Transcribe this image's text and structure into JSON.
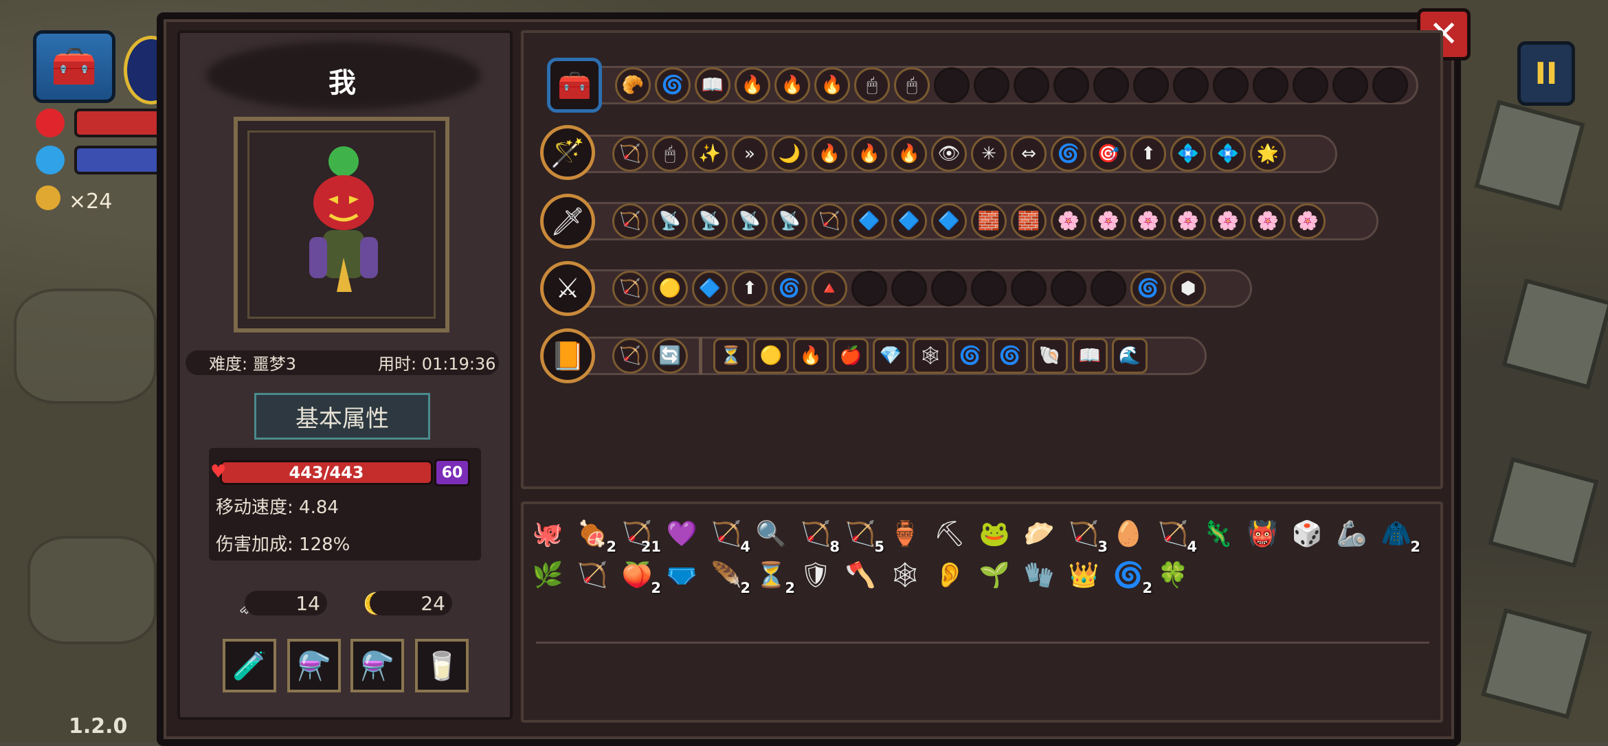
{
  "hud": {
    "coin_count": "×24",
    "version": "1.2.0",
    "pause_label": "II",
    "hp_color": "#c52d2d",
    "mp_color": "#3a4fb0"
  },
  "panel": {
    "close_label": "✕",
    "player_name": "我",
    "difficulty": "难度: 噩梦3",
    "time_used": "用时: 01:19:36",
    "tab_basic": "基本属性",
    "hp_text": "443/443",
    "shield_value": "60",
    "move_speed": "移动速度: 4.84",
    "damage_bonus": "伤害加成: 128%",
    "keys": "14",
    "coins": "24",
    "potions": [
      "🧪",
      "⚗️",
      "⚗️",
      "🥛"
    ]
  },
  "loadout": {
    "row1": {
      "weapon_icon": "chest-icon",
      "weapon_glyph": "🧰",
      "slots": [
        "🥐",
        "🌀",
        "📖",
        "🔥",
        "🔥",
        "🔥",
        "🖱",
        "🖱",
        "",
        "",
        "",
        "",
        "",
        "",
        "",
        "",
        "",
        "",
        "",
        ""
      ]
    },
    "row2": {
      "weapon_glyph": "🪄",
      "slots": [
        "🏹",
        "🖱",
        "✨",
        "»",
        "🌙",
        "🔥",
        "🔥",
        "🔥",
        "👁",
        "✳",
        "⇔",
        "🌀",
        "🎯",
        "⬆",
        "💠",
        "💠",
        "🌟"
      ]
    },
    "row3": {
      "weapon_glyph": "🗡",
      "slots": [
        "🏹",
        "📡",
        "📡",
        "📡",
        "📡",
        "🏹",
        "🔷",
        "🔷",
        "🔷",
        "🧱",
        "🧱",
        "🌸",
        "🌸",
        "🌸",
        "🌸",
        "🌸",
        "🌸",
        "🌸"
      ]
    },
    "row4": {
      "weapon_glyph": "⚔",
      "slots": [
        "🏹",
        "🟡",
        "🔷",
        "⬆",
        "🌀",
        "🔺",
        "",
        "",
        "",
        "",
        "",
        "",
        "",
        "🌀",
        "⬢"
      ]
    },
    "row5": {
      "weapon_glyph": "📙",
      "slots_a": [
        "🏹",
        "🔄"
      ],
      "slots_b": [
        "⏳",
        "🟡",
        "🔥",
        "🍎",
        "💎",
        "🕸",
        "🌀",
        "🌀",
        "🐚",
        "📖",
        "🌊"
      ]
    }
  },
  "inventory": {
    "row1": [
      {
        "g": "🐙",
        "c": ""
      },
      {
        "g": "🍖",
        "c": "2"
      },
      {
        "g": "🏹",
        "c": "21"
      },
      {
        "g": "💜",
        "c": ""
      },
      {
        "g": "🏹",
        "c": "4"
      },
      {
        "g": "🔍",
        "c": ""
      },
      {
        "g": "🏹",
        "c": "8"
      },
      {
        "g": "🏹",
        "c": "5"
      },
      {
        "g": "🏺",
        "c": ""
      },
      {
        "g": "⛏",
        "c": ""
      },
      {
        "g": "🐸",
        "c": ""
      },
      {
        "g": "🥟",
        "c": ""
      },
      {
        "g": "🏹",
        "c": "3"
      },
      {
        "g": "🥚",
        "c": ""
      },
      {
        "g": "🏹",
        "c": "4"
      },
      {
        "g": "🦎",
        "c": ""
      },
      {
        "g": "👹",
        "c": ""
      },
      {
        "g": "🎲",
        "c": ""
      },
      {
        "g": "🦾",
        "c": ""
      },
      {
        "g": "🧥",
        "c": "2"
      }
    ],
    "row2": [
      {
        "g": "🌿",
        "c": ""
      },
      {
        "g": "🏹",
        "c": ""
      },
      {
        "g": "🍑",
        "c": "2"
      },
      {
        "g": "🩲",
        "c": ""
      },
      {
        "g": "🪶",
        "c": "2"
      },
      {
        "g": "⏳",
        "c": "2"
      },
      {
        "g": "🛡",
        "c": ""
      },
      {
        "g": "🪓",
        "c": ""
      },
      {
        "g": "🕸",
        "c": ""
      },
      {
        "g": "👂",
        "c": ""
      },
      {
        "g": "🌱",
        "c": ""
      },
      {
        "g": "🧤",
        "c": ""
      },
      {
        "g": "👑",
        "c": ""
      },
      {
        "g": "🌀",
        "c": "2"
      },
      {
        "g": "🍀",
        "c": ""
      }
    ]
  }
}
